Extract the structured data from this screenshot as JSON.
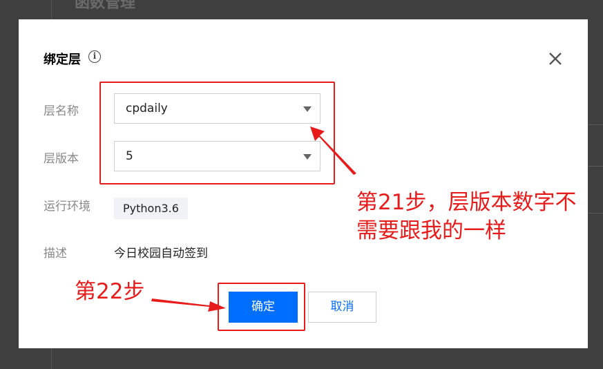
{
  "backdrop": {
    "title": "函数管理"
  },
  "dialog": {
    "title": "绑定层",
    "info_icon": "info-circle-icon",
    "close_icon": "close-x-icon",
    "fields": {
      "layer_name": {
        "label": "层名称",
        "value": "cpdaily"
      },
      "layer_version": {
        "label": "层版本",
        "value": "5"
      },
      "runtime": {
        "label": "运行环境",
        "value": "Python3.6"
      },
      "description": {
        "label": "描述",
        "value": "今日校园自动签到"
      }
    },
    "buttons": {
      "confirm": "确定",
      "cancel": "取消"
    }
  },
  "annotations": {
    "step21_line1": "第21步，层版本数字不",
    "step21_line2": "需要跟我的一样",
    "step22": "第22步",
    "color": "#e81b1b"
  },
  "colors": {
    "primary": "#006eff",
    "overlay": "#3f3f3f"
  }
}
